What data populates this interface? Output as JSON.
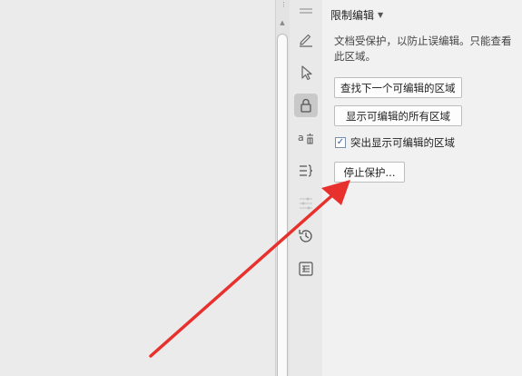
{
  "panel": {
    "title": "限制编辑",
    "description": "文档受保护，以防止误编辑。只能查看此区域。",
    "find_next_button": "查找下一个可编辑的区域",
    "show_all_button": "显示可编辑的所有区域",
    "highlight_checkbox_label": "突出显示可编辑的区域",
    "highlight_checked": true,
    "checkmark": "✓",
    "stop_protection_button": "停止保护..."
  },
  "rail": {
    "icons": [
      "collapse-icon",
      "pen-icon",
      "pointer-icon",
      "lock-icon",
      "translate-icon",
      "outline-icon",
      "adjust-icon",
      "history-icon",
      "backup-icon"
    ],
    "active_icon": "lock-icon"
  },
  "annotation": {
    "arrow_color": "#e8302d"
  },
  "scrollbar": {
    "grip_symbol": "⋮",
    "up_symbol": "▲"
  }
}
